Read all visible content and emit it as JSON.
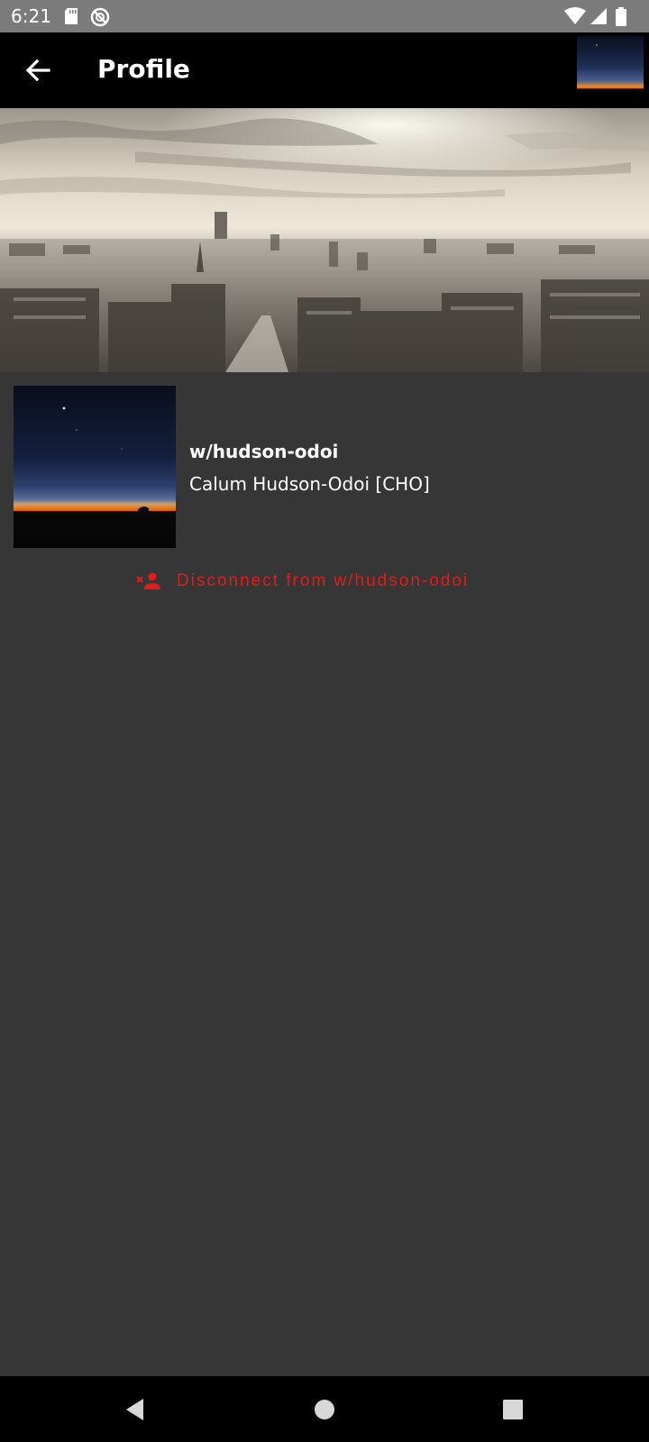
{
  "status_bar": {
    "time": "6:21",
    "icons": [
      "sd-card-icon",
      "no-sync-icon",
      "wifi-icon",
      "signal-icon",
      "battery-icon"
    ]
  },
  "toolbar": {
    "back_icon": "arrow-left-icon",
    "title": "Profile"
  },
  "profile": {
    "handle": "w/hudson-odoi",
    "display_name": "Calum Hudson-Odoi [CHO]"
  },
  "actions": {
    "disconnect_label": "Disconnect from w/hudson-odoi",
    "disconnect_icon": "remove-person-icon"
  },
  "colors": {
    "toolbar_bg": "#000000",
    "content_bg": "#363636",
    "status_bar_bg": "#7b7b7b",
    "danger": "#e01c1c"
  },
  "nav_bar": {
    "icons": [
      "back-triangle-icon",
      "home-circle-icon",
      "recents-square-icon"
    ]
  }
}
